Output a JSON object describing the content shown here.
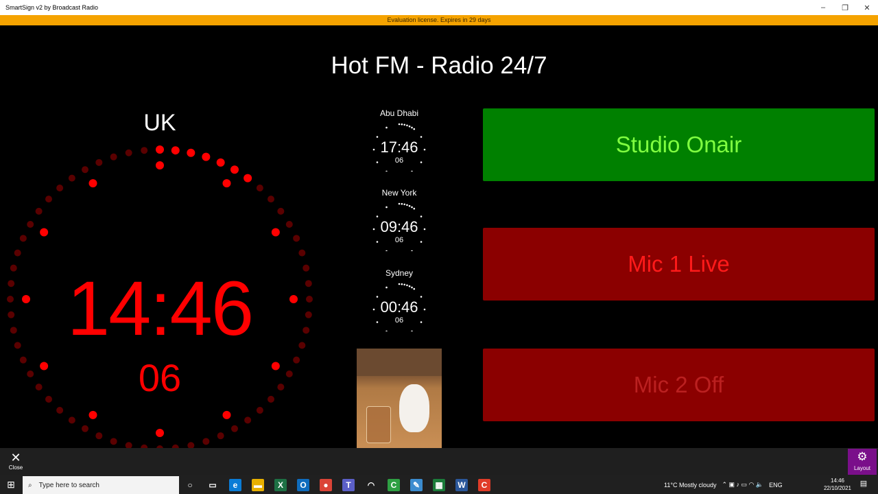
{
  "window": {
    "title": "SmartSign v2 by Broadcast Radio",
    "minimize": "–",
    "restore": "❐",
    "close": "✕"
  },
  "license_banner": "Evaluation license.  Expires in 29 days",
  "station_title": "Hot FM - Radio 24/7",
  "main_clock": {
    "label": "UK",
    "time": "14:46",
    "seconds": "06",
    "color": "#ff0000"
  },
  "world_clocks": [
    {
      "city": "Abu Dhabi",
      "time": "17:46",
      "seconds": "06"
    },
    {
      "city": "New York",
      "time": "09:46",
      "seconds": "06"
    },
    {
      "city": "Sydney",
      "time": "00:46",
      "seconds": "06"
    }
  ],
  "panels": [
    {
      "label": "Studio Onair",
      "state": "on",
      "bg": "#008000",
      "fg": "#80ff40"
    },
    {
      "label": "Mic 1 Live",
      "state": "on",
      "bg": "#8b0000",
      "fg": "#ff1a1a"
    },
    {
      "label": "Mic 2 Off",
      "state": "off",
      "bg": "#8b0000",
      "fg": "#bb2020"
    }
  ],
  "app_bar": {
    "close_label": "Close",
    "close_glyph": "✕",
    "layout_label": "Layout",
    "layout_glyph": "⚙",
    "layout_color": "#7a0f8a"
  },
  "taskbar": {
    "start_glyph": "⊞",
    "search_glyph": "⌕",
    "search_placeholder": "Type here to search",
    "apps": [
      {
        "name": "cortana-icon",
        "glyph": "○",
        "color": "#202020"
      },
      {
        "name": "task-view-icon",
        "glyph": "▭",
        "color": "#202020"
      },
      {
        "name": "edge-icon",
        "glyph": "e",
        "color": "#0a7cd6"
      },
      {
        "name": "file-explorer-icon",
        "glyph": "▬",
        "color": "#e8b000"
      },
      {
        "name": "excel-icon",
        "glyph": "X",
        "color": "#1d7044"
      },
      {
        "name": "outlook-icon",
        "glyph": "O",
        "color": "#0f6cbd"
      },
      {
        "name": "chrome-icon",
        "glyph": "●",
        "color": "#db4437"
      },
      {
        "name": "teams-icon",
        "glyph": "T",
        "color": "#5b5fc7"
      },
      {
        "name": "wifi-app-icon",
        "glyph": "◠",
        "color": "#202020"
      },
      {
        "name": "camtasia-icon",
        "glyph": "C",
        "color": "#2ea043"
      },
      {
        "name": "notes-icon",
        "glyph": "✎",
        "color": "#3b8ccf"
      },
      {
        "name": "smartsign-icon",
        "glyph": "▦",
        "color": "#1b7c3a"
      },
      {
        "name": "word-icon",
        "glyph": "W",
        "color": "#2b579a"
      },
      {
        "name": "recorder-icon",
        "glyph": "C",
        "color": "#e03c28"
      }
    ],
    "weather": "11°C  Mostly cloudy",
    "language": "ENG",
    "clock_time": "14:46",
    "clock_date": "22/10/2021"
  }
}
